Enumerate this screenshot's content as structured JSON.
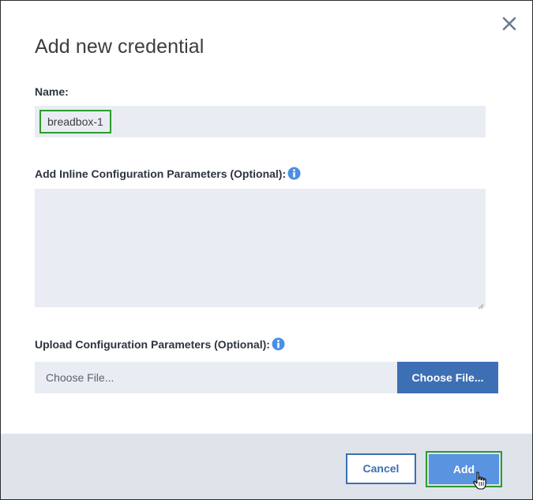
{
  "dialog": {
    "title": "Add new credential",
    "close_icon": "close-icon"
  },
  "name": {
    "label": "Name:",
    "value": "breadbox-1"
  },
  "inline_params": {
    "label": "Add Inline Configuration Parameters (Optional):",
    "info_icon": "info-icon",
    "value": ""
  },
  "upload_params": {
    "label": "Upload Configuration Parameters (Optional):",
    "info_icon": "info-icon",
    "file_placeholder": "Choose File...",
    "button_label": "Choose File..."
  },
  "footer": {
    "cancel_label": "Cancel",
    "add_label": "Add"
  },
  "colors": {
    "accent": "#3d6fb4",
    "primary_button": "#5a93e0",
    "highlight": "#2a9d2a",
    "field_bg": "#e9edf3",
    "footer_bg": "#dfe3ea"
  }
}
